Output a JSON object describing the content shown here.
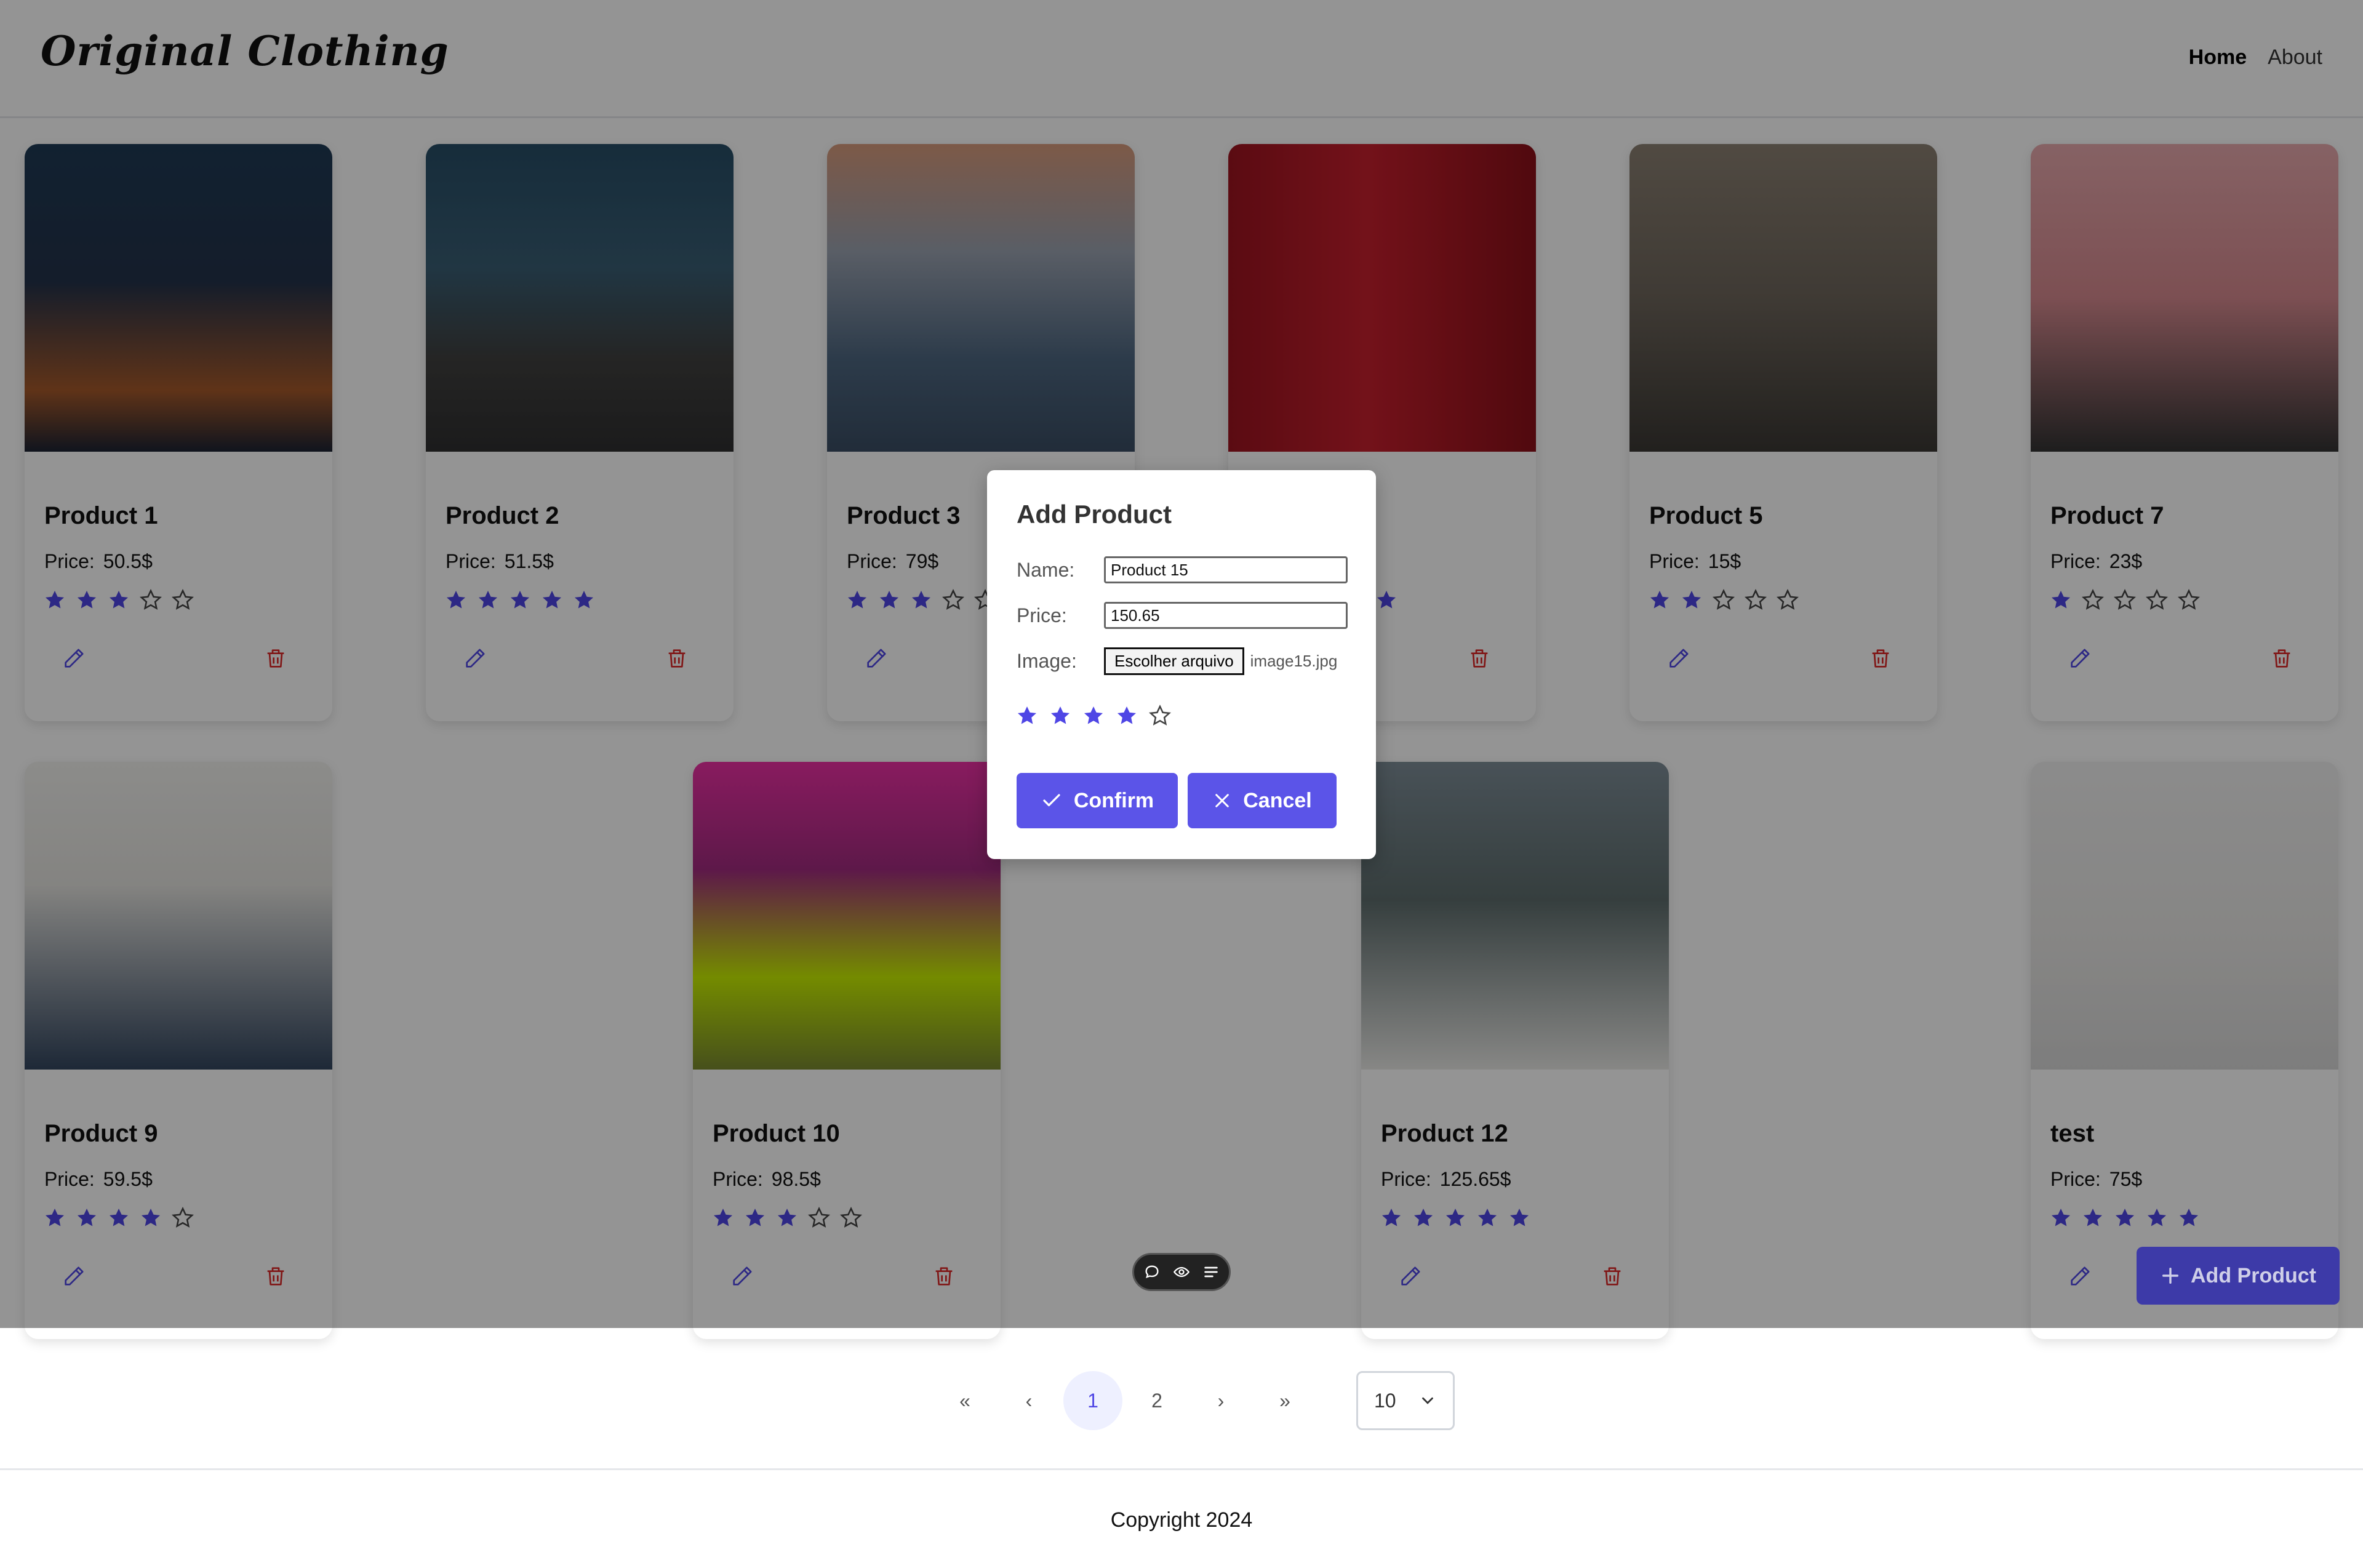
{
  "header": {
    "logo": "Original Clothing",
    "nav": [
      {
        "label": "Home",
        "active": true
      },
      {
        "label": "About",
        "active": false
      }
    ]
  },
  "price_label": "Price:",
  "colors": {
    "accent": "#5b54e8",
    "star_filled": "#4f46e5",
    "delete_icon": "#dc2626"
  },
  "products": [
    {
      "name": "Product 1",
      "price": "50.5$",
      "rating": 3
    },
    {
      "name": "Product 2",
      "price": "51.5$",
      "rating": 5
    },
    {
      "name": "Product 3",
      "price": "79$",
      "rating": 3
    },
    {
      "name": "",
      "price": "",
      "rating": 5
    },
    {
      "name": "Product 5",
      "price": "15$",
      "rating": 2
    },
    {
      "name": "Product 7",
      "price": "23$",
      "rating": 1
    },
    {
      "name": "Product 9",
      "price": "59.5$",
      "rating": 4
    },
    {
      "name": "Product 10",
      "price": "98.5$",
      "rating": 3
    },
    {
      "name": "Product 12",
      "price": "125.65$",
      "rating": 5
    },
    {
      "name": "test",
      "price": "75$",
      "rating": 5
    }
  ],
  "pagination": {
    "first": "«",
    "prev": "‹",
    "pages": [
      "1",
      "2"
    ],
    "current": "1",
    "next": "›",
    "last": "»",
    "page_size": "10"
  },
  "fab": {
    "label": "Add Product",
    "icon": "plus-icon"
  },
  "footer": {
    "text": "Copyright 2024"
  },
  "modal": {
    "title": "Add Product",
    "name_label": "Name:",
    "name_value": "Product 15",
    "price_label": "Price:",
    "price_value": "150.65",
    "image_label": "Image:",
    "file_button": "Escolher arquivo",
    "file_name": "image15.jpg",
    "rating": 4,
    "confirm_label": "Confirm",
    "cancel_label": "Cancel"
  }
}
